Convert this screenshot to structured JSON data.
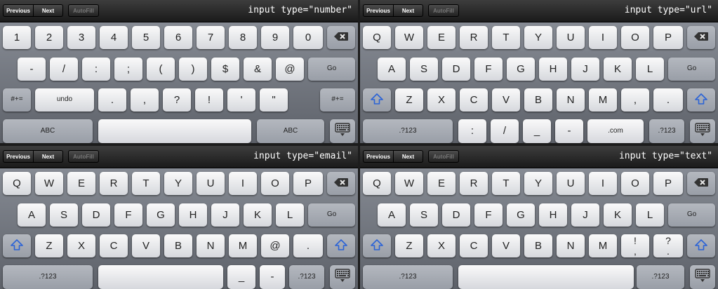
{
  "toolbar": {
    "previous": "Previous",
    "next": "Next",
    "autofill": "AutoFill"
  },
  "keyboards": [
    {
      "label": "input type=\"number\"",
      "rows": [
        {
          "keys": [
            {
              "t": "1",
              "l": 4,
              "w": 40
            },
            {
              "t": "2",
              "l": 50,
              "w": 40
            },
            {
              "t": "3",
              "l": 96,
              "w": 40
            },
            {
              "t": "4",
              "l": 142,
              "w": 40
            },
            {
              "t": "5",
              "l": 188,
              "w": 40
            },
            {
              "t": "6",
              "l": 234,
              "w": 40
            },
            {
              "t": "7",
              "l": 280,
              "w": 40
            },
            {
              "t": "8",
              "l": 326,
              "w": 40
            },
            {
              "t": "9",
              "l": 372,
              "w": 40
            },
            {
              "t": "0",
              "l": 418,
              "w": 42
            },
            {
              "icon": "backspace-icon",
              "l": 466,
              "w": 40,
              "dark": true
            }
          ]
        },
        {
          "keys": [
            {
              "t": "-",
              "l": 25,
              "w": 40
            },
            {
              "t": "/",
              "l": 71,
              "w": 40
            },
            {
              "t": ":",
              "l": 117,
              "w": 40
            },
            {
              "t": ";",
              "l": 163,
              "w": 40
            },
            {
              "t": "(",
              "l": 209,
              "w": 40
            },
            {
              "t": ")",
              "l": 255,
              "w": 40
            },
            {
              "t": "$",
              "l": 301,
              "w": 40
            },
            {
              "t": "&",
              "l": 347,
              "w": 40
            },
            {
              "t": "@",
              "l": 393,
              "w": 40
            },
            {
              "t": "Go",
              "l": 439,
              "w": 67,
              "dark": true,
              "small": true
            }
          ]
        },
        {
          "keys": [
            {
              "t": "#+=",
              "l": 4,
              "w": 40,
              "dark": true,
              "small": true
            },
            {
              "t": "undo",
              "l": 50,
              "w": 84,
              "small": true
            },
            {
              "t": ".",
              "l": 140,
              "w": 40
            },
            {
              "t": ",",
              "l": 186,
              "w": 40
            },
            {
              "t": "?",
              "l": 232,
              "w": 40
            },
            {
              "t": "!",
              "l": 278,
              "w": 40
            },
            {
              "t": "'",
              "l": 324,
              "w": 40
            },
            {
              "t": "\"",
              "l": 370,
              "w": 40
            },
            {
              "t": "#+=",
              "l": 456,
              "w": 50,
              "dark": true,
              "small": true
            }
          ]
        },
        {
          "keys": [
            {
              "t": "ABC",
              "l": 4,
              "w": 128,
              "dark": true,
              "small": true
            },
            {
              "t": "",
              "l": 140,
              "w": 218
            },
            {
              "t": "ABC",
              "l": 366,
              "w": 96,
              "dark": true,
              "small": true
            },
            {
              "icon": "keyboard-hide-icon",
              "l": 470,
              "w": 36,
              "dark": true
            }
          ]
        }
      ]
    },
    {
      "label": "input type=\"url\"",
      "rows": [
        {
          "keys": [
            {
              "t": "Q",
              "l": 4,
              "w": 40
            },
            {
              "t": "W",
              "l": 50,
              "w": 40
            },
            {
              "t": "E",
              "l": 96,
              "w": 40
            },
            {
              "t": "R",
              "l": 142,
              "w": 40
            },
            {
              "t": "T",
              "l": 188,
              "w": 40
            },
            {
              "t": "Y",
              "l": 234,
              "w": 40
            },
            {
              "t": "U",
              "l": 280,
              "w": 40
            },
            {
              "t": "I",
              "l": 326,
              "w": 40
            },
            {
              "t": "O",
              "l": 372,
              "w": 40
            },
            {
              "t": "P",
              "l": 418,
              "w": 42
            },
            {
              "icon": "backspace-icon",
              "l": 466,
              "w": 40,
              "dark": true
            }
          ]
        },
        {
          "keys": [
            {
              "t": "A",
              "l": 25,
              "w": 40
            },
            {
              "t": "S",
              "l": 71,
              "w": 40
            },
            {
              "t": "D",
              "l": 117,
              "w": 40
            },
            {
              "t": "F",
              "l": 163,
              "w": 40
            },
            {
              "t": "G",
              "l": 209,
              "w": 40
            },
            {
              "t": "H",
              "l": 255,
              "w": 40
            },
            {
              "t": "J",
              "l": 301,
              "w": 40
            },
            {
              "t": "K",
              "l": 347,
              "w": 40
            },
            {
              "t": "L",
              "l": 393,
              "w": 40
            },
            {
              "t": "Go",
              "l": 439,
              "w": 67,
              "dark": true,
              "small": true
            }
          ]
        },
        {
          "keys": [
            {
              "icon": "shift-icon",
              "l": 4,
              "w": 40,
              "dark": true
            },
            {
              "t": "Z",
              "l": 50,
              "w": 40
            },
            {
              "t": "X",
              "l": 96,
              "w": 40
            },
            {
              "t": "C",
              "l": 142,
              "w": 40
            },
            {
              "t": "V",
              "l": 188,
              "w": 40
            },
            {
              "t": "B",
              "l": 234,
              "w": 40
            },
            {
              "t": "N",
              "l": 280,
              "w": 40
            },
            {
              "t": "M",
              "l": 326,
              "w": 40
            },
            {
              "t": ",",
              "l": 372,
              "w": 40
            },
            {
              "t": ".",
              "l": 418,
              "w": 42
            },
            {
              "icon": "shift-icon",
              "l": 466,
              "w": 40,
              "dark": true
            }
          ]
        },
        {
          "keys": [
            {
              "t": ".?123",
              "l": 4,
              "w": 128,
              "dark": true,
              "small": true
            },
            {
              "t": ":",
              "l": 140,
              "w": 40
            },
            {
              "t": "/",
              "l": 186,
              "w": 40
            },
            {
              "t": "_",
              "l": 232,
              "w": 40
            },
            {
              "t": "-",
              "l": 278,
              "w": 40
            },
            {
              "t": ".com",
              "l": 324,
              "w": 80,
              "small": true
            },
            {
              "t": ".?123",
              "l": 412,
              "w": 50,
              "dark": true,
              "small": true
            },
            {
              "icon": "keyboard-hide-icon",
              "l": 470,
              "w": 36,
              "dark": true
            }
          ]
        }
      ]
    },
    {
      "label": "input type=\"email\"",
      "rows": [
        {
          "keys": [
            {
              "t": "Q",
              "l": 4,
              "w": 40
            },
            {
              "t": "W",
              "l": 50,
              "w": 40
            },
            {
              "t": "E",
              "l": 96,
              "w": 40
            },
            {
              "t": "R",
              "l": 142,
              "w": 40
            },
            {
              "t": "T",
              "l": 188,
              "w": 40
            },
            {
              "t": "Y",
              "l": 234,
              "w": 40
            },
            {
              "t": "U",
              "l": 280,
              "w": 40
            },
            {
              "t": "I",
              "l": 326,
              "w": 40
            },
            {
              "t": "O",
              "l": 372,
              "w": 40
            },
            {
              "t": "P",
              "l": 418,
              "w": 42
            },
            {
              "icon": "backspace-icon",
              "l": 466,
              "w": 40,
              "dark": true
            }
          ]
        },
        {
          "keys": [
            {
              "t": "A",
              "l": 25,
              "w": 40
            },
            {
              "t": "S",
              "l": 71,
              "w": 40
            },
            {
              "t": "D",
              "l": 117,
              "w": 40
            },
            {
              "t": "F",
              "l": 163,
              "w": 40
            },
            {
              "t": "G",
              "l": 209,
              "w": 40
            },
            {
              "t": "H",
              "l": 255,
              "w": 40
            },
            {
              "t": "J",
              "l": 301,
              "w": 40
            },
            {
              "t": "K",
              "l": 347,
              "w": 40
            },
            {
              "t": "L",
              "l": 393,
              "w": 40
            },
            {
              "t": "Go",
              "l": 439,
              "w": 67,
              "dark": true,
              "small": true
            }
          ]
        },
        {
          "keys": [
            {
              "icon": "shift-icon",
              "l": 4,
              "w": 40,
              "dark": true
            },
            {
              "t": "Z",
              "l": 50,
              "w": 40
            },
            {
              "t": "X",
              "l": 96,
              "w": 40
            },
            {
              "t": "C",
              "l": 142,
              "w": 40
            },
            {
              "t": "V",
              "l": 188,
              "w": 40
            },
            {
              "t": "B",
              "l": 234,
              "w": 40
            },
            {
              "t": "N",
              "l": 280,
              "w": 40
            },
            {
              "t": "M",
              "l": 326,
              "w": 40
            },
            {
              "t": "@",
              "l": 372,
              "w": 40
            },
            {
              "t": ".",
              "l": 418,
              "w": 42
            },
            {
              "icon": "shift-icon",
              "l": 466,
              "w": 40,
              "dark": true
            }
          ]
        },
        {
          "keys": [
            {
              "t": ".?123",
              "l": 4,
              "w": 128,
              "dark": true,
              "small": true
            },
            {
              "t": "",
              "l": 140,
              "w": 178
            },
            {
              "t": "_",
              "l": 324,
              "w": 40
            },
            {
              "t": "-",
              "l": 370,
              "w": 36
            },
            {
              "t": ".?123",
              "l": 412,
              "w": 50,
              "dark": true,
              "small": true
            },
            {
              "icon": "keyboard-hide-icon",
              "l": 470,
              "w": 36,
              "dark": true
            }
          ]
        }
      ]
    },
    {
      "label": "input type=\"text\"",
      "rows": [
        {
          "keys": [
            {
              "t": "Q",
              "l": 4,
              "w": 40
            },
            {
              "t": "W",
              "l": 50,
              "w": 40
            },
            {
              "t": "E",
              "l": 96,
              "w": 40
            },
            {
              "t": "R",
              "l": 142,
              "w": 40
            },
            {
              "t": "T",
              "l": 188,
              "w": 40
            },
            {
              "t": "Y",
              "l": 234,
              "w": 40
            },
            {
              "t": "U",
              "l": 280,
              "w": 40
            },
            {
              "t": "I",
              "l": 326,
              "w": 40
            },
            {
              "t": "O",
              "l": 372,
              "w": 40
            },
            {
              "t": "P",
              "l": 418,
              "w": 42
            },
            {
              "icon": "backspace-icon",
              "l": 466,
              "w": 40,
              "dark": true
            }
          ]
        },
        {
          "keys": [
            {
              "t": "A",
              "l": 25,
              "w": 40
            },
            {
              "t": "S",
              "l": 71,
              "w": 40
            },
            {
              "t": "D",
              "l": 117,
              "w": 40
            },
            {
              "t": "F",
              "l": 163,
              "w": 40
            },
            {
              "t": "G",
              "l": 209,
              "w": 40
            },
            {
              "t": "H",
              "l": 255,
              "w": 40
            },
            {
              "t": "J",
              "l": 301,
              "w": 40
            },
            {
              "t": "K",
              "l": 347,
              "w": 40
            },
            {
              "t": "L",
              "l": 393,
              "w": 40
            },
            {
              "t": "Go",
              "l": 439,
              "w": 67,
              "dark": true,
              "small": true
            }
          ]
        },
        {
          "keys": [
            {
              "icon": "shift-icon",
              "l": 4,
              "w": 40,
              "dark": true
            },
            {
              "t": "Z",
              "l": 50,
              "w": 40
            },
            {
              "t": "X",
              "l": 96,
              "w": 40
            },
            {
              "t": "C",
              "l": 142,
              "w": 40
            },
            {
              "t": "V",
              "l": 188,
              "w": 40
            },
            {
              "t": "B",
              "l": 234,
              "w": 40
            },
            {
              "t": "N",
              "l": 280,
              "w": 40
            },
            {
              "t": "M",
              "l": 326,
              "w": 40
            },
            {
              "t": "!\n,",
              "l": 372,
              "w": 40,
              "stack": true
            },
            {
              "t": "?\n.",
              "l": 418,
              "w": 42,
              "stack": true
            },
            {
              "icon": "shift-icon",
              "l": 466,
              "w": 40,
              "dark": true
            }
          ]
        },
        {
          "keys": [
            {
              "t": ".?123",
              "l": 4,
              "w": 128,
              "dark": true,
              "small": true
            },
            {
              "t": "",
              "l": 140,
              "w": 250
            },
            {
              "t": ".?123",
              "l": 394,
              "w": 68,
              "dark": true,
              "small": true
            },
            {
              "icon": "keyboard-hide-icon",
              "l": 470,
              "w": 36,
              "dark": true
            }
          ]
        }
      ]
    }
  ],
  "colors": {
    "shift": "#2b63d6",
    "icon": "#333333"
  }
}
